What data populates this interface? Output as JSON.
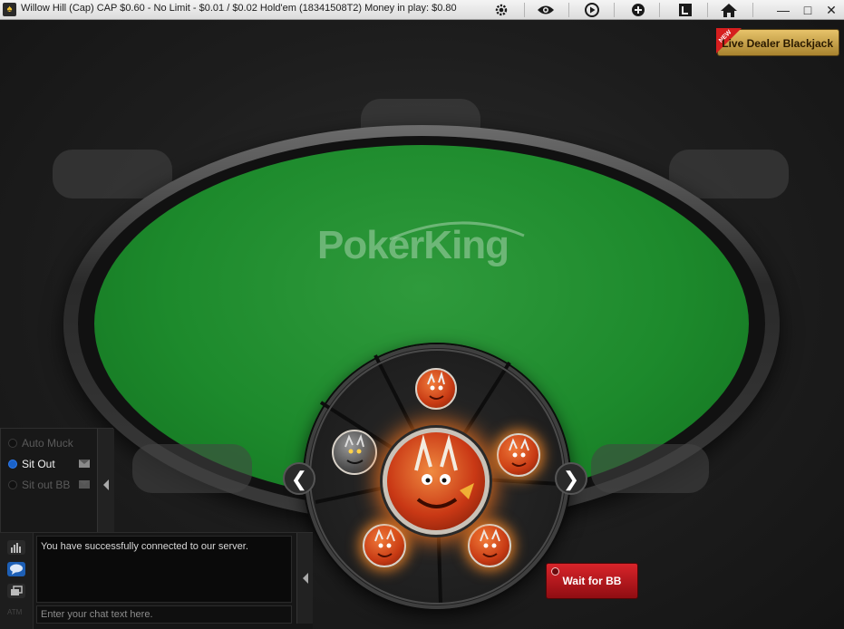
{
  "window": {
    "title": "Willow Hill (Cap) CAP $0.60 - No Limit - $0.01 / $0.02 Hold'em (18341508T2) Money in play: $0.80",
    "toolbar_icons": [
      "settings-icon",
      "eye-icon",
      "replay-icon",
      "add-table-icon",
      "lobby-icon",
      "home-icon"
    ],
    "window_controls": {
      "minimize": "—",
      "maximize": "□",
      "close": "✕"
    }
  },
  "promo": {
    "new_tag": "NEW",
    "label": "Live Dealer Blackjack"
  },
  "table": {
    "logo": "PokerKing",
    "felt_color": "#1d8a2c"
  },
  "avatar_picker": {
    "prev_arrow": "❮",
    "next_arrow": "❯",
    "avatars": [
      "red-dragon-top",
      "grey-dragon",
      "red-dragon-right",
      "red-dragon-bottom-left",
      "red-dragon-bottom-right"
    ],
    "selected": "red-dragon-center"
  },
  "actions": {
    "wait_for_bb": "Wait for BB"
  },
  "options": {
    "items": [
      {
        "label": "Auto Muck",
        "selected": false,
        "enabled": false
      },
      {
        "label": "Sit Out",
        "selected": true,
        "enabled": true
      },
      {
        "label": "Sit out BB",
        "selected": false,
        "enabled": false
      }
    ]
  },
  "chat": {
    "message": "You have successfully connected to our server.",
    "placeholder": "Enter your chat text here.",
    "side_icons": [
      "stats-icon",
      "chat-bubble-icon",
      "windows-icon"
    ],
    "atm_label": "ATM"
  },
  "colors": {
    "wait_button": "#c8191f",
    "promo_gold": "#d9b45a",
    "radio_on": "#1a62c8"
  }
}
